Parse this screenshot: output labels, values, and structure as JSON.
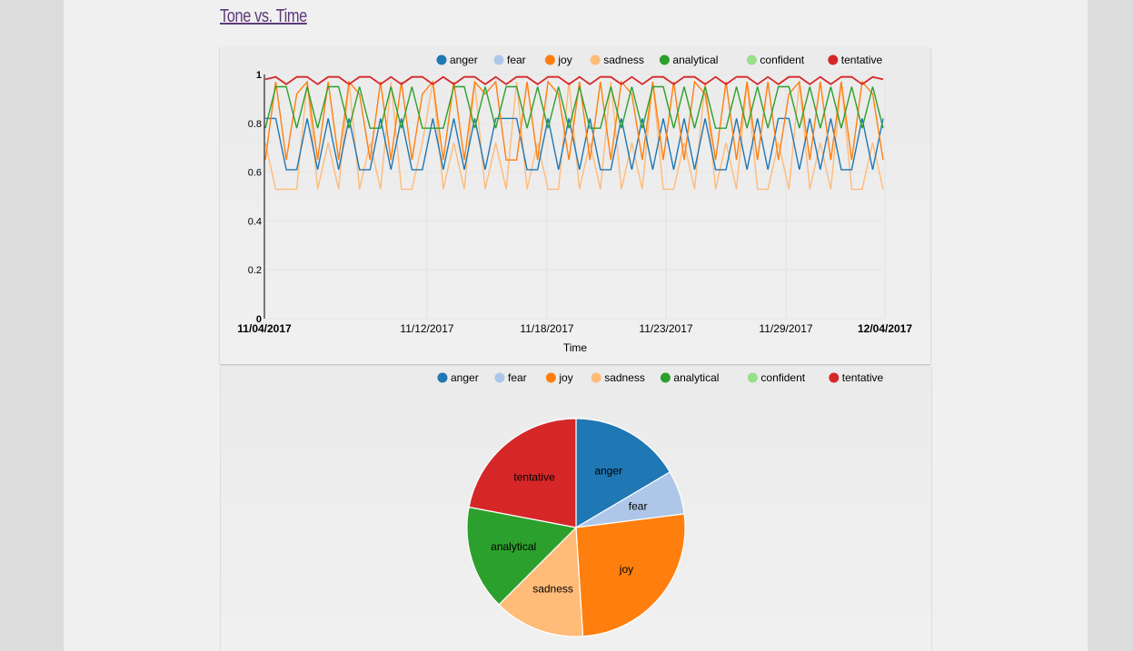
{
  "page": {
    "title": "Tone vs. Time"
  },
  "colors": {
    "anger": "#1f77b4",
    "fear": "#aec7e8",
    "joy": "#ff7f0e",
    "sadness": "#ffbb78",
    "analytical": "#2ca02c",
    "confident": "#98df8a",
    "tentative": "#d62728"
  },
  "chart_data": [
    {
      "type": "line",
      "xlabel": "Time",
      "ylabel": "",
      "ylim": [
        0,
        1
      ],
      "yticks": [
        "0",
        "0.2",
        "0.4",
        "0.6",
        "0.8",
        "1"
      ],
      "xticks": [
        "11/04/2017",
        "11/12/2017",
        "11/18/2017",
        "11/23/2017",
        "11/29/2017",
        "12/04/2017"
      ],
      "xticks_bold": [
        "11/04/2017",
        "12/04/2017"
      ],
      "legend": [
        "anger",
        "fear",
        "joy",
        "sadness",
        "analytical",
        "confident",
        "tentative"
      ],
      "legend_position": "top-right",
      "series": [
        {
          "name": "anger",
          "values": [
            0.82,
            0.82,
            0.61,
            0.61,
            0.82,
            0.61,
            0.82,
            0.61,
            0.82,
            0.61,
            0.61,
            0.82,
            0.61,
            0.82,
            0.61,
            0.61,
            0.82,
            0.61,
            0.82,
            0.61,
            0.82,
            0.61,
            0.82,
            0.82,
            0.82,
            0.61,
            0.61,
            0.82,
            0.61,
            0.82,
            0.61,
            0.82,
            0.61,
            0.61,
            0.82,
            0.61,
            0.82,
            0.61,
            0.82,
            0.61,
            0.82,
            0.61,
            0.82,
            0.61,
            0.61,
            0.82,
            0.61,
            0.82,
            0.61,
            0.82,
            0.82,
            0.61,
            0.82,
            0.61,
            0.82,
            0.61,
            0.61,
            0.82,
            0.61,
            0.82
          ]
        },
        {
          "name": "joy",
          "values": [
            0.65,
            0.97,
            0.65,
            0.92,
            0.97,
            0.65,
            0.97,
            0.65,
            0.97,
            0.92,
            0.65,
            0.97,
            0.65,
            0.97,
            0.65,
            0.92,
            0.97,
            0.65,
            0.97,
            0.65,
            0.97,
            0.92,
            0.97,
            0.65,
            0.65,
            0.97,
            0.65,
            0.97,
            0.92,
            0.65,
            0.97,
            0.65,
            0.97,
            0.65,
            0.97,
            0.92,
            0.65,
            0.97,
            0.65,
            0.97,
            0.65,
            0.97,
            0.92,
            0.65,
            0.97,
            0.65,
            0.97,
            0.65,
            0.97,
            0.65,
            0.92,
            0.97,
            0.65,
            0.97,
            0.65,
            0.97,
            0.65,
            0.97,
            0.92,
            0.65
          ]
        },
        {
          "name": "sadness",
          "values": [
            0.72,
            0.53,
            0.53,
            0.53,
            0.97,
            0.53,
            0.72,
            0.53,
            0.97,
            0.53,
            0.72,
            0.53,
            0.97,
            0.53,
            0.53,
            0.72,
            0.97,
            0.53,
            0.72,
            0.53,
            0.97,
            0.53,
            0.72,
            0.53,
            0.97,
            0.53,
            0.72,
            0.53,
            0.53,
            0.97,
            0.53,
            0.72,
            0.53,
            0.97,
            0.53,
            0.72,
            0.53,
            0.97,
            0.53,
            0.53,
            0.72,
            0.53,
            0.97,
            0.53,
            0.72,
            0.53,
            0.97,
            0.53,
            0.53,
            0.72,
            0.53,
            0.97,
            0.53,
            0.72,
            0.53,
            0.97,
            0.53,
            0.53,
            0.72,
            0.53
          ]
        },
        {
          "name": "analytical",
          "values": [
            0.78,
            0.95,
            0.95,
            0.78,
            0.95,
            0.78,
            0.95,
            0.95,
            0.78,
            0.95,
            0.78,
            0.78,
            0.95,
            0.78,
            0.95,
            0.78,
            0.78,
            0.78,
            0.95,
            0.95,
            0.78,
            0.95,
            0.78,
            0.95,
            0.95,
            0.78,
            0.95,
            0.78,
            0.95,
            0.78,
            0.95,
            0.78,
            0.78,
            0.95,
            0.78,
            0.95,
            0.78,
            0.95,
            0.95,
            0.78,
            0.95,
            0.78,
            0.95,
            0.78,
            0.78,
            0.95,
            0.78,
            0.95,
            0.78,
            0.95,
            0.95,
            0.78,
            0.95,
            0.78,
            0.95,
            0.78,
            0.95,
            0.78,
            0.95,
            0.78
          ]
        },
        {
          "name": "tentative",
          "values": [
            0.98,
            0.99,
            0.96,
            0.99,
            0.99,
            0.96,
            0.99,
            0.99,
            0.96,
            0.99,
            0.99,
            0.96,
            0.99,
            0.96,
            0.99,
            0.99,
            0.96,
            0.99,
            0.96,
            0.99,
            0.99,
            0.96,
            0.99,
            0.96,
            0.99,
            0.99,
            0.96,
            0.99,
            0.99,
            0.96,
            0.99,
            0.96,
            0.99,
            0.99,
            0.96,
            0.99,
            0.96,
            0.99,
            0.99,
            0.96,
            0.99,
            0.99,
            0.96,
            0.99,
            0.96,
            0.99,
            0.99,
            0.96,
            0.99,
            0.96,
            0.99,
            0.99,
            0.96,
            0.99,
            0.96,
            0.99,
            0.99,
            0.96,
            0.99,
            0.98
          ]
        }
      ]
    },
    {
      "type": "pie",
      "legend": [
        "anger",
        "fear",
        "joy",
        "sadness",
        "analytical",
        "confident",
        "tentative"
      ],
      "legend_position": "top-right",
      "slices": [
        {
          "name": "anger",
          "value": 16.5
        },
        {
          "name": "fear",
          "value": 6.5
        },
        {
          "name": "joy",
          "value": 26.0
        },
        {
          "name": "sadness",
          "value": 13.5
        },
        {
          "name": "analytical",
          "value": 15.5
        },
        {
          "name": "tentative",
          "value": 22.0
        }
      ]
    }
  ]
}
